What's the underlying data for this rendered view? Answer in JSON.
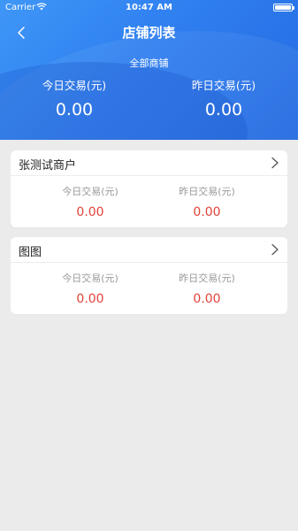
{
  "status_bar": {
    "carrier": "Carrier",
    "time": "10:47 AM"
  },
  "header": {
    "title": "店铺列表",
    "subtitle": "全部商铺",
    "today_label": "今日交易(元)",
    "today_value": "0.00",
    "yesterday_label": "昨日交易(元)",
    "yesterday_value": "0.00"
  },
  "stores": [
    {
      "name": "张测试商户",
      "today_label": "今日交易(元)",
      "today_value": "0.00",
      "yesterday_label": "昨日交易(元)",
      "yesterday_value": "0.00"
    },
    {
      "name": "图图",
      "today_label": "今日交易(元)",
      "today_value": "0.00",
      "yesterday_label": "昨日交易(元)",
      "yesterday_value": "0.00"
    }
  ],
  "colors": {
    "header_blue": "#2f7ff0",
    "value_red": "#e0423a",
    "background": "#ebebeb"
  },
  "icons": {
    "back": "chevron-left-icon",
    "wifi": "wifi-icon",
    "battery": "battery-icon",
    "row_arrow": "chevron-right-icon"
  }
}
